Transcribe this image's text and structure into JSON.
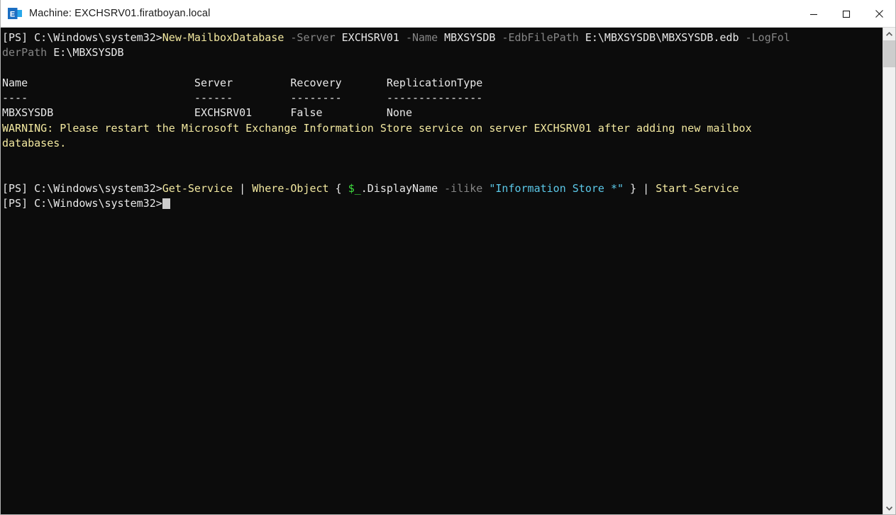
{
  "window": {
    "title": "Machine: EXCHSRV01.firatboyan.local",
    "icon": "exchange-logo-icon",
    "controls": {
      "minimize": "minimize-button",
      "maximize": "maximize-button",
      "close": "close-button"
    }
  },
  "colors": {
    "console_background": "#0c0c0c",
    "titlebar_background": "#ffffff",
    "default_text": "#e8e8e8",
    "cmdlet": "#f3e9a0",
    "parameter": "#868686",
    "string": "#5bc8e8",
    "variable": "#3fe03f",
    "warning": "#f3e9a0",
    "scrollbar_track": "#f0f0f0",
    "scrollbar_thumb": "#cdcdcd"
  },
  "console": {
    "prompt": "[PS] C:\\Windows\\system32>",
    "cursor": "block",
    "lines": [
      {
        "id": "cmd-new-mailboxdatabase",
        "segments": [
          {
            "text": "[PS] C:\\Windows\\system32>",
            "style": "default"
          },
          {
            "text": "New-MailboxDatabase",
            "style": "cmdlet"
          },
          {
            "text": " ",
            "style": "default"
          },
          {
            "text": "-Server",
            "style": "param"
          },
          {
            "text": " EXCHSRV01 ",
            "style": "default"
          },
          {
            "text": "-Name",
            "style": "param"
          },
          {
            "text": " MBXSYSDB ",
            "style": "default"
          },
          {
            "text": "-EdbFilePath",
            "style": "param"
          },
          {
            "text": " E:\\MBXSYSDB\\MBXSYSDB.edb ",
            "style": "default"
          },
          {
            "text": "-LogFol",
            "style": "param"
          }
        ]
      },
      {
        "id": "cmd-new-mailboxdatabase-wrap",
        "segments": [
          {
            "text": "derPath",
            "style": "param"
          },
          {
            "text": " E:\\MBXSYSDB",
            "style": "default"
          }
        ]
      },
      {
        "id": "blank-1",
        "segments": []
      },
      {
        "id": "table-header",
        "segments": [
          {
            "text": "Name                          Server         Recovery       ReplicationType",
            "style": "header"
          }
        ]
      },
      {
        "id": "table-rule",
        "segments": [
          {
            "text": "----                          ------         --------       ---------------",
            "style": "header"
          }
        ]
      },
      {
        "id": "table-row-1",
        "segments": [
          {
            "text": "MBXSYSDB                      EXCHSRV01      False          None",
            "style": "default"
          }
        ]
      },
      {
        "id": "warning-line-1",
        "segments": [
          {
            "text": "WARNING: Please restart the Microsoft Exchange Information Store service on server EXCHSRV01 after adding new mailbox",
            "style": "warning"
          }
        ]
      },
      {
        "id": "warning-line-2",
        "segments": [
          {
            "text": "databases.",
            "style": "warning"
          }
        ]
      },
      {
        "id": "blank-2",
        "segments": []
      },
      {
        "id": "blank-3",
        "segments": []
      },
      {
        "id": "cmd-get-service",
        "segments": [
          {
            "text": "[PS] C:\\Windows\\system32>",
            "style": "default"
          },
          {
            "text": "Get-Service",
            "style": "cmdlet"
          },
          {
            "text": " | ",
            "style": "default"
          },
          {
            "text": "Where-Object",
            "style": "cmdlet"
          },
          {
            "text": " { ",
            "style": "default"
          },
          {
            "text": "$_",
            "style": "variable"
          },
          {
            "text": ".DisplayName ",
            "style": "default"
          },
          {
            "text": "-ilike",
            "style": "param"
          },
          {
            "text": " ",
            "style": "default"
          },
          {
            "text": "\"Information Store *\"",
            "style": "string"
          },
          {
            "text": " } | ",
            "style": "default"
          },
          {
            "text": "Start-Service",
            "style": "cmdlet"
          }
        ]
      },
      {
        "id": "prompt-active",
        "cursor": true,
        "segments": [
          {
            "text": "[PS] C:\\Windows\\system32>",
            "style": "default"
          }
        ]
      }
    ]
  },
  "scrollbar": {
    "up_arrow": "scroll-up-icon",
    "down_arrow": "scroll-down-icon",
    "thumb": "scroll-thumb"
  }
}
